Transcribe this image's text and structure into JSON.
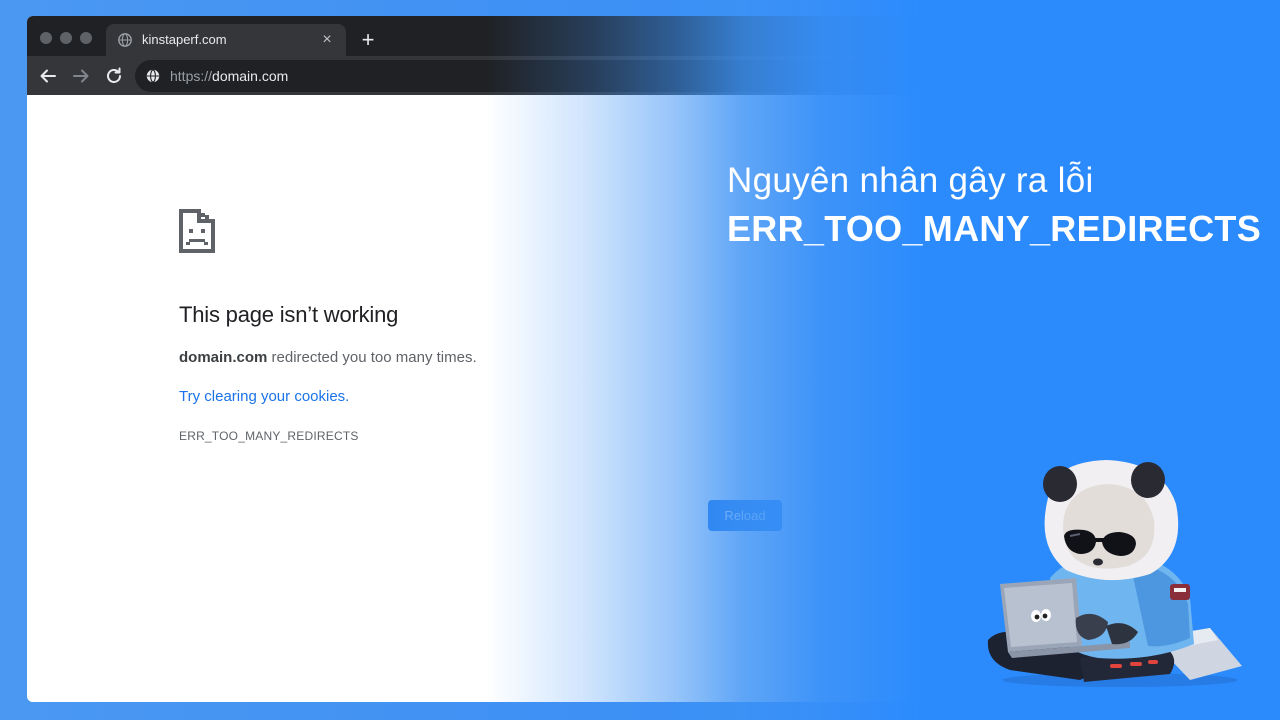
{
  "browser": {
    "tab": {
      "title": "kinstaperf.com"
    },
    "new_tab_glyph": "+",
    "close_glyph": "×",
    "address_bar": {
      "scheme": "https://",
      "host": "domain.com"
    }
  },
  "error_page": {
    "title": "This page isn’t working",
    "description_domain": "domain.com",
    "description_rest": " redirected you too many times.",
    "link": "Try clearing your cookies.",
    "error_code": "ERR_TOO_MANY_REDIRECTS",
    "reload_button": "Reload"
  },
  "headline": {
    "line1": "Nguyên nhân gây ra lỗi",
    "line2": "ERR_TOO_MANY_REDIRECTS"
  },
  "icons": {
    "tab_favicon": "globe-icon",
    "back": "arrow-left-icon",
    "forward": "arrow-right-icon",
    "reload": "reload-icon",
    "address_site_info": "globe-icon",
    "error": "sad-page-icon"
  },
  "colors": {
    "background_blue": "#2b8bfd",
    "link_blue": "#1a73e8",
    "chrome_dark": "#202124"
  }
}
